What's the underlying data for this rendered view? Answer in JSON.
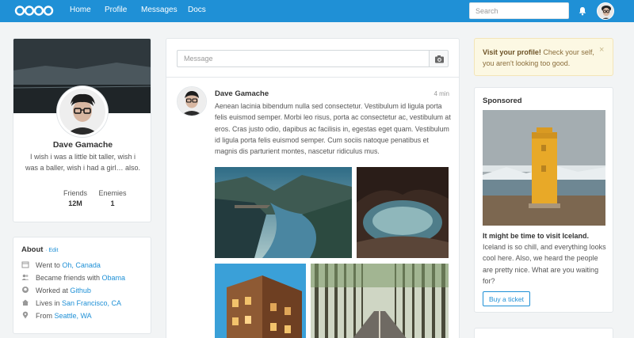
{
  "nav": {
    "links": [
      "Home",
      "Profile",
      "Messages",
      "Docs"
    ],
    "search_placeholder": "Search"
  },
  "profile": {
    "name": "Dave Gamache",
    "bio": "I wish i was a little bit taller, wish i was a baller, wish i had a girl… also.",
    "stats": [
      {
        "label": "Friends",
        "value": "12M"
      },
      {
        "label": "Enemies",
        "value": "1"
      }
    ]
  },
  "about": {
    "title": "About",
    "edit_label": "· Edit",
    "items": [
      {
        "icon": "calendar-icon",
        "prefix": "Went to ",
        "link": "Oh, Canada"
      },
      {
        "icon": "users-icon",
        "prefix": "Became friends with ",
        "link": "Obama"
      },
      {
        "icon": "github-icon",
        "prefix": "Worked at ",
        "link": "Github"
      },
      {
        "icon": "home-icon",
        "prefix": "Lives in ",
        "link": "San Francisco, CA"
      },
      {
        "icon": "location-icon",
        "prefix": "From ",
        "link": "Seattle, WA"
      }
    ]
  },
  "composer": {
    "placeholder": "Message"
  },
  "post": {
    "author": "Dave Gamache",
    "time": "4 min",
    "text": "Aenean lacinia bibendum nulla sed consectetur. Vestibulum id ligula porta felis euismod semper. Morbi leo risus, porta ac consectetur ac, vestibulum at eros. Cras justo odio, dapibus ac facilisis in, egestas eget quam. Vestibulum id ligula porta felis euismod semper. Cum sociis natoque penatibus et magnis dis parturient montes, nascetur ridiculus mus."
  },
  "alert": {
    "bold": "Visit your profile!",
    "text": " Check your self, you aren't looking too good.",
    "close": "×"
  },
  "sponsored": {
    "title": "Sponsored",
    "headline": "It might be time to visit Iceland.",
    "body": " Iceland is so chill, and everything looks cool here. Also, we heard the people are pretty nice. What are you waiting for?",
    "button": "Buy a ticket"
  },
  "colors": {
    "brand": "#1f90d6",
    "background": "#f2f4f5",
    "alert_bg": "#fcf8e3"
  }
}
